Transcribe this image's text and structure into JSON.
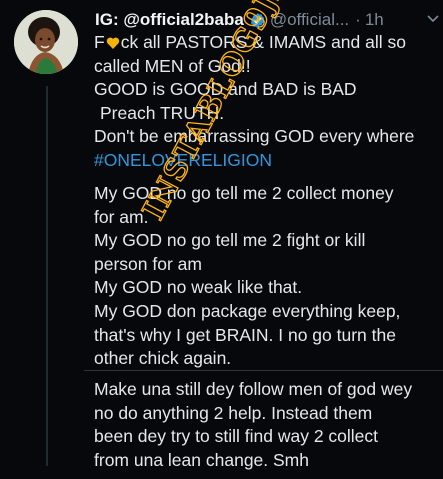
{
  "tweet": {
    "author_name": "IG: @official2baba",
    "handle": "@official...",
    "separator": "·",
    "time": "1h",
    "lines": [
      "F",
      "ck all PASTORS & IMAMS and all so",
      "called MEN of God!!",
      "GOOD is GOOD and BAD is BAD",
      "Preach TRUTH.",
      "Don't be embarrassing GOD every where",
      "#ONELOVERELIGION"
    ]
  },
  "reply_1": {
    "lines": [
      "My GOD no go tell me 2 collect money",
      "for am.",
      "My GOD no go tell me 2 fight or kill",
      "person for am",
      "My GOD no weak like that.",
      "My GOD don package everything keep,",
      "that's why I get BRAIN. I no go turn the",
      "other chick again."
    ]
  },
  "reply_2": {
    "lines": [
      "Make una still dey follow men of god wey",
      "no do anything 2 help. Instead them",
      "been dey try to still find way 2 collect",
      "from una lean change. Smh"
    ]
  },
  "watermark": {
    "text": "INSTABLOG9JA"
  },
  "colors": {
    "background": "#06080b",
    "text": "#e4e8ec",
    "muted": "#7d8a95",
    "hashtag": "#2f97dd",
    "verified": "#1d9bf0",
    "watermark": "#ffb31a"
  },
  "icons": {
    "verified": "verified-badge-icon",
    "censor": "heart-censor-icon",
    "caret": "chevron-down-icon"
  }
}
